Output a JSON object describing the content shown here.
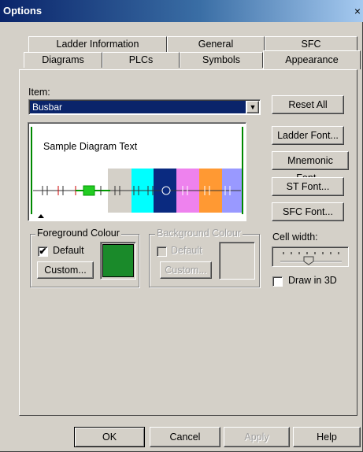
{
  "window": {
    "title": "Options",
    "close_glyph": "×"
  },
  "tabs": {
    "row1": [
      "Ladder Information",
      "General",
      "SFC"
    ],
    "row2": [
      "Diagrams",
      "PLCs",
      "Symbols",
      "Appearance"
    ]
  },
  "item": {
    "label": "Item:",
    "value": "Busbar"
  },
  "preview": {
    "sample_text": "Sample Diagram Text",
    "segment_colors": [
      "#d4d0c8",
      "#00ffff",
      "#0a2a80",
      "#ee82ee",
      "#ff9933",
      "#9999ff"
    ]
  },
  "foreground": {
    "title": "Foreground Colour",
    "default_label": "Default",
    "default_checked": true,
    "custom_label": "Custom...",
    "swatch_color": "#1a8a2a"
  },
  "background": {
    "title": "Background Colour",
    "default_label": "Default",
    "custom_label": "Custom..."
  },
  "side_buttons": {
    "reset_all": "Reset All",
    "ladder_font": "Ladder Font...",
    "mnemonic_font": "Mnemonic Font...",
    "st_font": "ST Font...",
    "sfc_font": "SFC Font..."
  },
  "cell_width": {
    "label": "Cell width:"
  },
  "draw_3d": {
    "label": "Draw in 3D",
    "checked": false
  },
  "footer": {
    "ok": "OK",
    "cancel": "Cancel",
    "apply": "Apply",
    "help": "Help"
  }
}
